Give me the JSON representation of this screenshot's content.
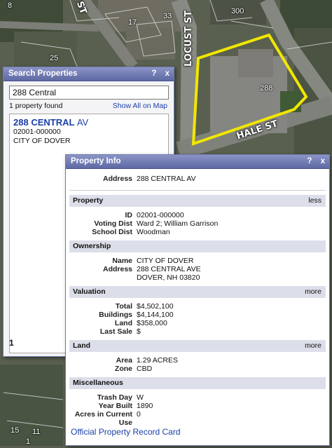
{
  "map": {
    "labels": {
      "lot_8": "8",
      "lot_17": "17",
      "lot_33": "33",
      "lot_300": "300",
      "lot_25": "25",
      "lot_288": "288",
      "lot_15": "15",
      "lot_11": "11",
      "lot_1": "1",
      "lot_st": "ST"
    },
    "streets": {
      "locust": "LOCUST ST",
      "hale": "HALE ST"
    },
    "highlight_color": "#f2e600"
  },
  "search": {
    "title": "Search Properties",
    "help": "?",
    "close": "x",
    "query": "288 Central",
    "count": "1 property found",
    "show_all": "Show All on Map",
    "result": {
      "number": "288",
      "street": "CENTRAL",
      "suffix": "AV",
      "id": "02001-000000",
      "city": "CITY OF DOVER"
    },
    "page": "1"
  },
  "info": {
    "title": "Property Info",
    "help": "?",
    "close": "x",
    "address_key": "Address",
    "address_val": "288 CENTRAL AV",
    "property": {
      "header": "Property",
      "toggle": "less",
      "id_k": "ID",
      "id_v": "02001-000000",
      "voting_k": "Voting Dist",
      "voting_v": "Ward 2; William Garrison",
      "school_k": "School Dist",
      "school_v": "Woodman"
    },
    "ownership": {
      "header": "Ownership",
      "name_k": "Name",
      "name_v": "CITY OF DOVER",
      "addr_k": "Address",
      "addr_v1": "288 CENTRAL AVE",
      "addr_v2": "DOVER, NH 03820"
    },
    "valuation": {
      "header": "Valuation",
      "toggle": "more",
      "total_k": "Total",
      "total_v": "$4,502,100",
      "bldg_k": "Buildings",
      "bldg_v": "$4,144,100",
      "land_k": "Land",
      "land_v": "$358,000",
      "sale_k": "Last Sale",
      "sale_v": "$"
    },
    "land": {
      "header": "Land",
      "toggle": "more",
      "area_k": "Area",
      "area_v": "1.29 ACRES",
      "zone_k": "Zone",
      "zone_v": "CBD"
    },
    "misc": {
      "header": "Miscellaneous",
      "trash_k": "Trash Day",
      "trash_v": "W",
      "year_k": "Year Built",
      "year_v": "1890",
      "acres_k1": "Acres in Current",
      "acres_k2": "Use",
      "acres_v": "0"
    },
    "record_card": "Official Property Record Card"
  }
}
